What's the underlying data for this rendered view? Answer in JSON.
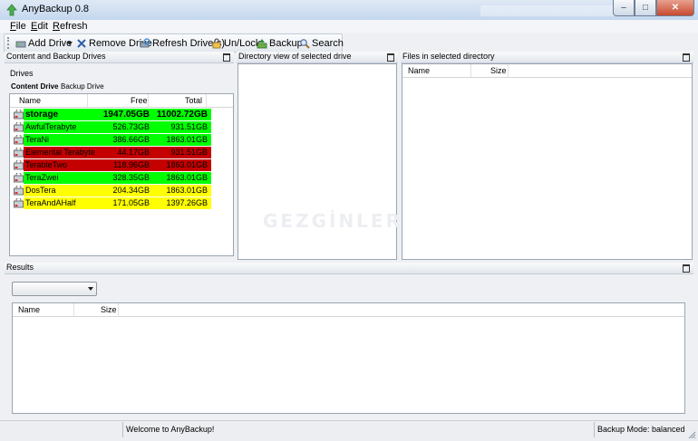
{
  "window": {
    "title": "AnyBackup 0.8"
  },
  "menu": {
    "items": [
      {
        "accel": "F",
        "rest": "ile"
      },
      {
        "accel": "E",
        "rest": "dit"
      },
      {
        "accel": "R",
        "rest": "efresh"
      }
    ]
  },
  "toolbar": {
    "add_drive": "Add Drive",
    "remove_drive": "Remove Drive",
    "refresh_drives": "Refresh Drive(s)",
    "unlock": "Un/Lock",
    "backup": "Backup",
    "search": "Search"
  },
  "panels": {
    "drives_panel_title": "Content and Backup Drives",
    "directory_panel_title": "Directory view of selected drive",
    "files_panel_title": "Files in selected directory",
    "results_panel_title": "Results"
  },
  "drives": {
    "label": "Drives",
    "tabs": [
      "Content Drive",
      "Backup Drive"
    ],
    "columns": {
      "name": "Name",
      "free": "Free",
      "total": "Total"
    },
    "rows": [
      {
        "name": "storage",
        "free": "1947.05GB",
        "total": "11002.72GB",
        "color": "#00ff00",
        "bold": true
      },
      {
        "name": "AwfulTerabyte",
        "free": "526.73GB",
        "total": "931.51GB",
        "color": "#00ff00"
      },
      {
        "name": "TeraNi",
        "free": "386.66GB",
        "total": "1863.01GB",
        "color": "#00ff00"
      },
      {
        "name": "Elemental Terabyte",
        "free": "44.17GB",
        "total": "931.51GB",
        "color": "#c40000"
      },
      {
        "name": "TerableTwo",
        "free": "118.96GB",
        "total": "1863.01GB",
        "color": "#c40000"
      },
      {
        "name": "TeraZwei",
        "free": "328.35GB",
        "total": "1863.01GB",
        "color": "#00ff00"
      },
      {
        "name": "DosTera",
        "free": "204.34GB",
        "total": "1863.01GB",
        "color": "#ffff00"
      },
      {
        "name": "TeraAndAHalf",
        "free": "171.05GB",
        "total": "1397.26GB",
        "color": "#ffff00"
      }
    ]
  },
  "files": {
    "columns": {
      "name": "Name",
      "size": "Size"
    }
  },
  "results": {
    "dropdown_value": "",
    "columns": {
      "name": "Name",
      "size": "Size"
    }
  },
  "status": {
    "message": "Welcome to AnyBackup!",
    "mode": "Backup Mode: balanced"
  },
  "watermark": "GEZGİNLER"
}
